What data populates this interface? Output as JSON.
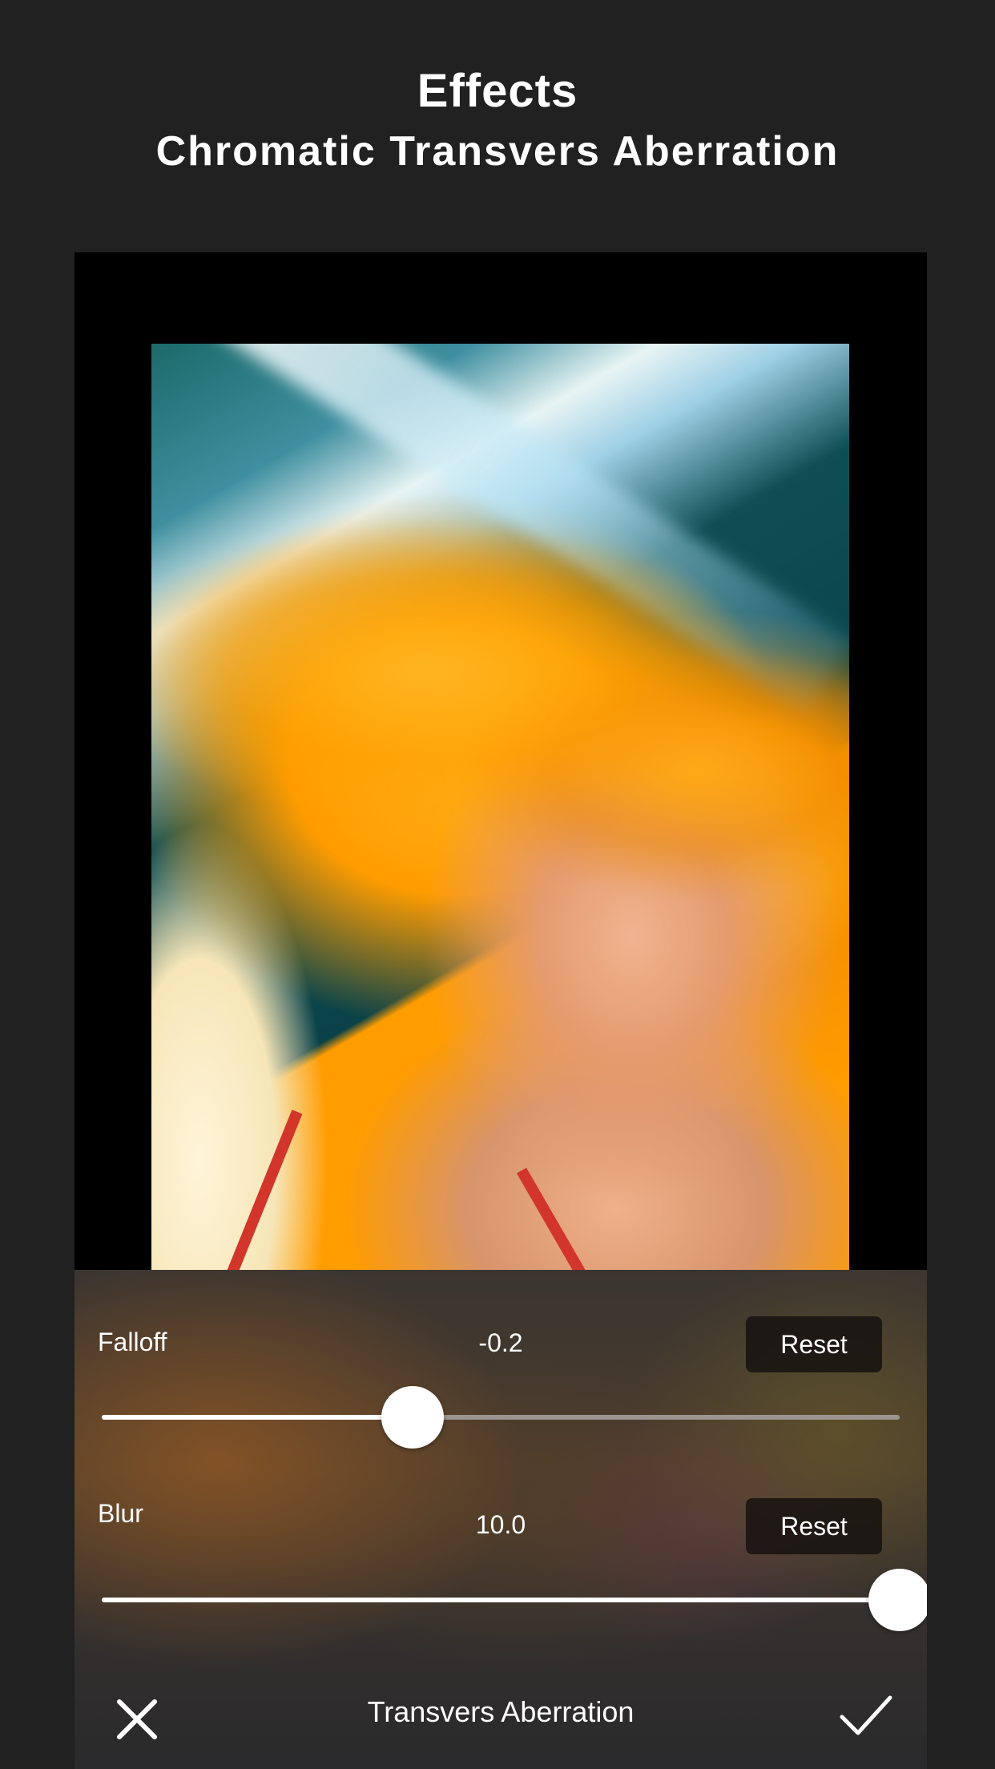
{
  "header": {
    "title": "Effects",
    "subtitle": "Chromatic Transvers Aberration"
  },
  "controls": {
    "falloff": {
      "label": "Falloff",
      "value": "-0.2",
      "reset_label": "Reset",
      "slider_fraction": 0.39
    },
    "blur": {
      "label": "Blur",
      "value": "10.0",
      "reset_label": "Reset",
      "slider_fraction": 1.0
    }
  },
  "toolbar": {
    "title": "Transvers Aberration",
    "cancel_icon": "close-icon",
    "confirm_icon": "checkmark-icon"
  },
  "colors": {
    "background": "#212121",
    "slider_track_active": "#ffffff",
    "slider_track_inactive": "#9a9590",
    "reset_button_bg": "#161210"
  }
}
